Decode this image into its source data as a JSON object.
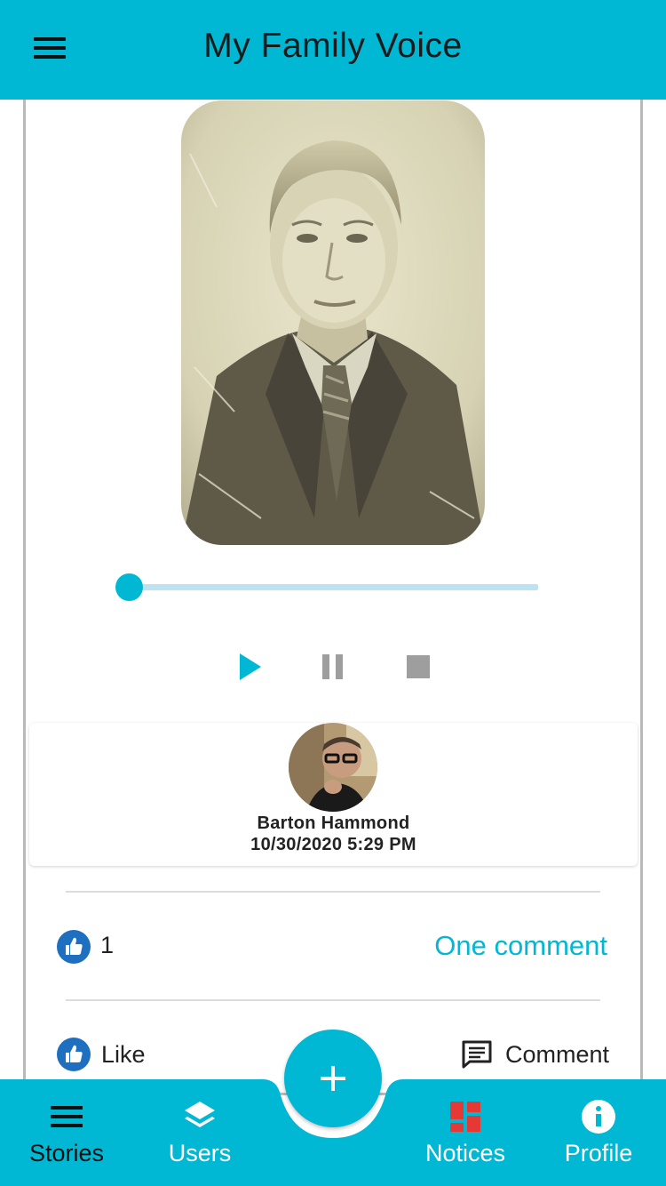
{
  "app": {
    "title": "My Family Voice",
    "colors": {
      "primary": "#00b8d4",
      "accent_red": "#e53935",
      "like_blue": "#1e6fbf"
    }
  },
  "header": {
    "menu_icon": "hamburger-menu-icon"
  },
  "story": {
    "photo_alt": "Vintage sepia portrait photo",
    "audio": {
      "progress": 0,
      "controls": [
        "play-icon",
        "pause-icon",
        "stop-icon"
      ]
    },
    "author": {
      "name": "Barton Hammond",
      "date": "10/30/2020 5:29 PM"
    },
    "likes": {
      "count": "1",
      "icon": "thumbs-up-icon"
    },
    "comments_link": "One comment",
    "actions": {
      "like_label": "Like",
      "comment_label": "Comment"
    }
  },
  "bottom_nav": {
    "items": [
      {
        "label": "Stories",
        "icon": "list-icon",
        "color": "#111111"
      },
      {
        "label": "Users",
        "icon": "layers-icon",
        "color": "#ffffff"
      },
      {
        "label": "Notices",
        "icon": "dashboard-icon",
        "color": "#ffffff"
      },
      {
        "label": "Profile",
        "icon": "info-icon",
        "color": "#ffffff"
      }
    ],
    "fab_icon": "plus-icon"
  }
}
